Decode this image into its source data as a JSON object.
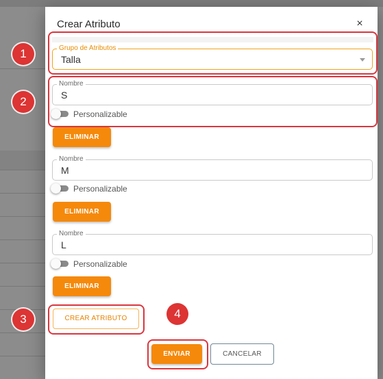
{
  "dialog": {
    "title": "Crear Atributo",
    "close_symbol": "×"
  },
  "group_select": {
    "label": "Grupo de Atributos",
    "value": "Talla"
  },
  "attributes": [
    {
      "name_label": "Nombre",
      "name_value": "S",
      "toggle_label": "Personalizable",
      "toggle_on": false,
      "delete_label": "ELIMINAR"
    },
    {
      "name_label": "Nombre",
      "name_value": "M",
      "toggle_label": "Personalizable",
      "toggle_on": false,
      "delete_label": "ELIMINAR"
    },
    {
      "name_label": "Nombre",
      "name_value": "L",
      "toggle_label": "Personalizable",
      "toggle_on": false,
      "delete_label": "ELIMINAR"
    }
  ],
  "actions": {
    "create_label": "CREAR ATRIBUTO",
    "submit_label": "ENVIAR",
    "cancel_label": "CANCELAR"
  },
  "annotations": [
    "1",
    "2",
    "3",
    "4"
  ],
  "colors": {
    "accent": "#f5890b",
    "highlight": "#d9363e",
    "badge": "#dd3434"
  }
}
